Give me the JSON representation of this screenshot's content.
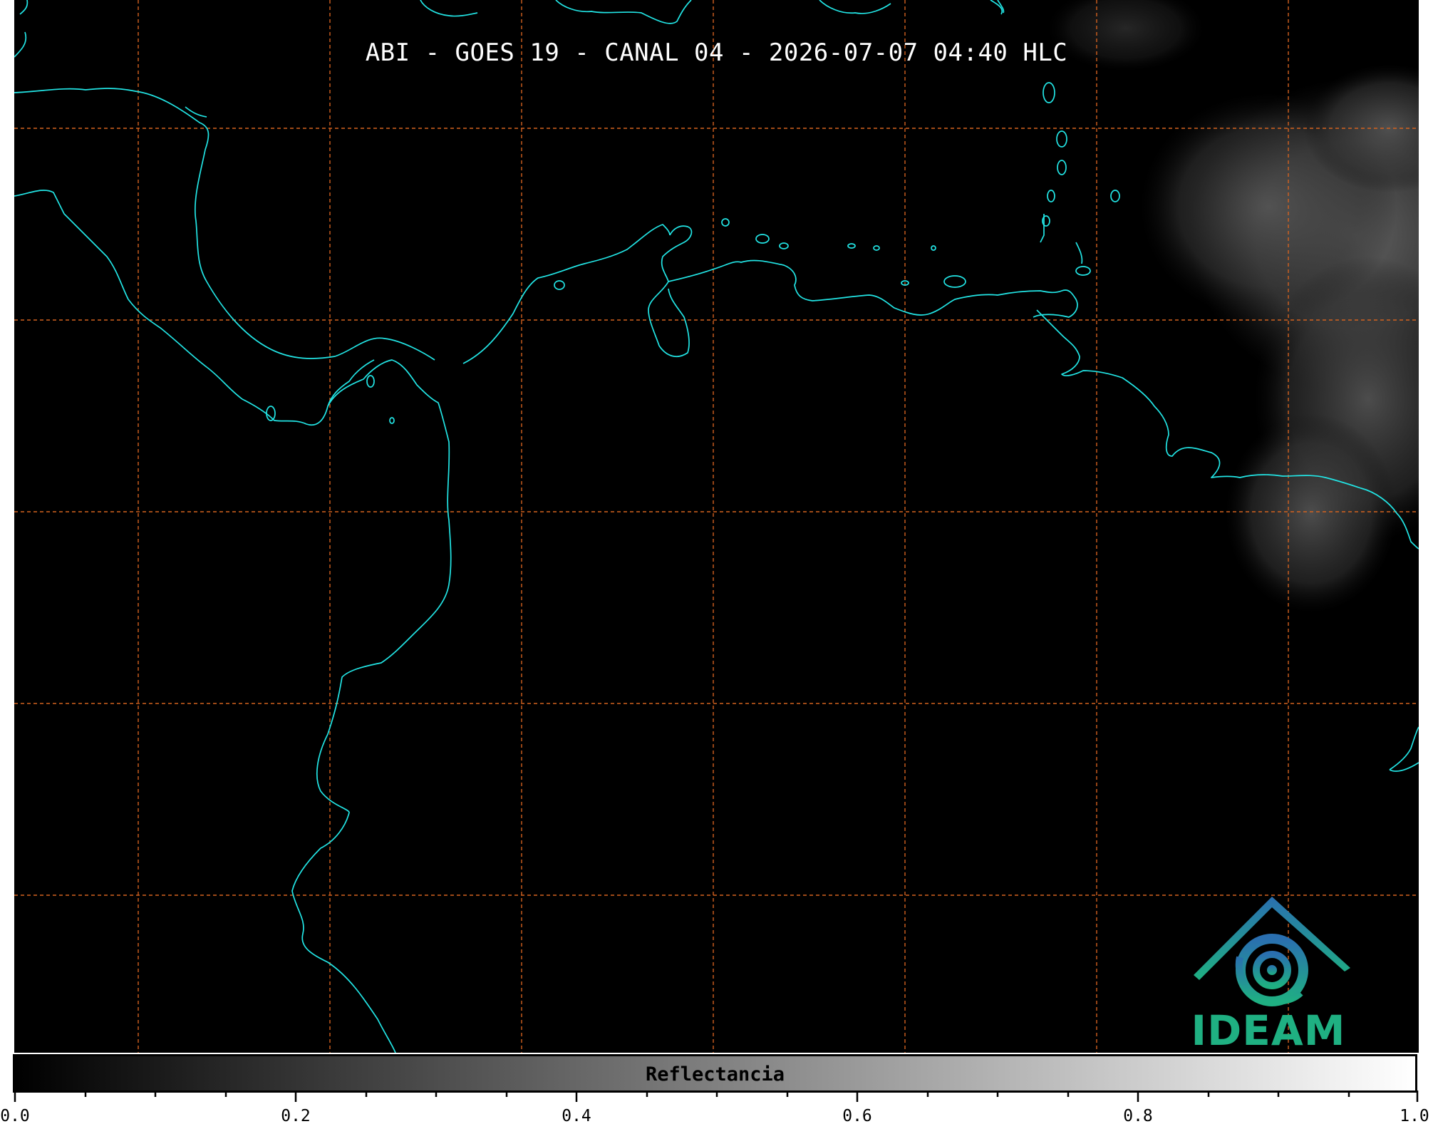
{
  "title": "ABI - GOES 19 - CANAL 04 - 2026-07-07 04:40 HLC",
  "logo": {
    "text": "IDEAM",
    "icon": "ideam-logo-icon"
  },
  "colorbar": {
    "label": "Reflectancia",
    "min": 0.0,
    "max": 1.0,
    "tick_labels": [
      "0.0",
      "0.2",
      "0.4",
      "0.6",
      "0.8",
      "1.0"
    ],
    "colormap_start": "#000000",
    "colormap_end": "#ffffff"
  },
  "map": {
    "background": "#000000",
    "coastline_color": "#22e5e5",
    "gridline_color": "#d4621f",
    "gridline_style": "dashed",
    "cloud_region": "east (upper right)"
  }
}
